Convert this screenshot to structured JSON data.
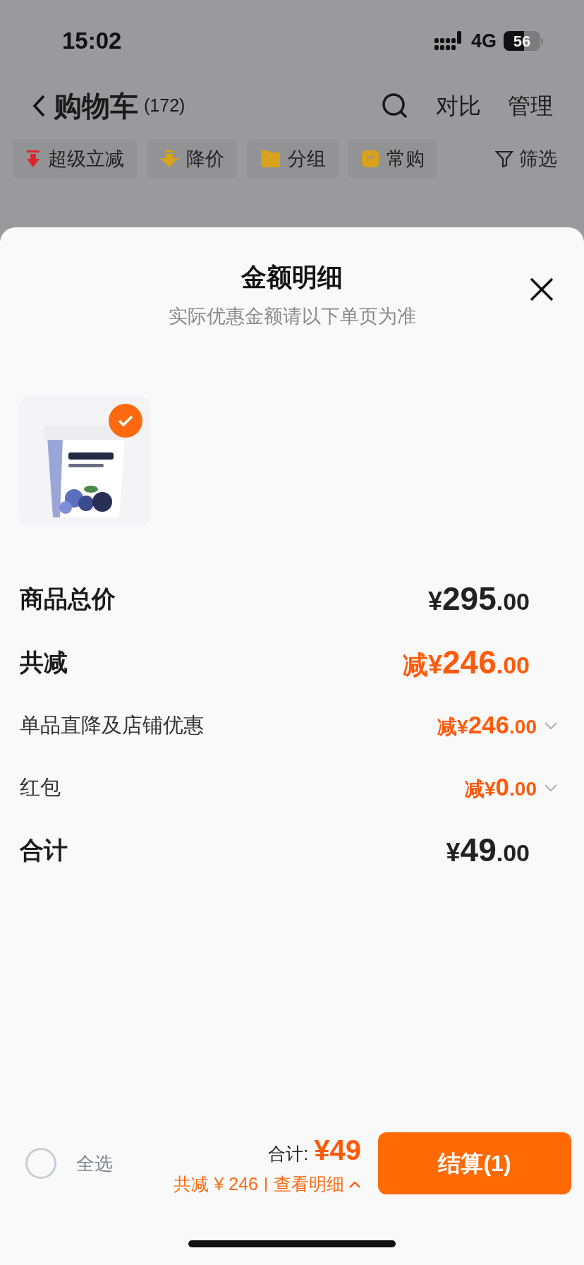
{
  "status_bar": {
    "time": "15:02",
    "network": "4G",
    "battery": "56"
  },
  "nav": {
    "title": "购物车",
    "count": "(172)",
    "actions": [
      "对比",
      "管理"
    ]
  },
  "chips": [
    {
      "label": "超级立减",
      "kind": "bolt"
    },
    {
      "label": "降价",
      "kind": "drop"
    },
    {
      "label": "分组",
      "kind": "folder"
    },
    {
      "label": "常购",
      "kind": "bag"
    }
  ],
  "filter": {
    "label": "筛选"
  },
  "sheet": {
    "title": "金额明细",
    "subtitle": "实际优惠金额请以下单页为准",
    "products": [
      {
        "kind": "picture",
        "selected": true
      }
    ],
    "rows": [
      {
        "label": "商品总价",
        "kind": "main",
        "highlight": false,
        "prefix": "",
        "currency": "¥",
        "whole": "295",
        "fraction": ".00"
      },
      {
        "label": "共减",
        "kind": "main",
        "highlight": true,
        "prefix": "减",
        "currency": "¥",
        "whole": "246",
        "fraction": ".00"
      },
      {
        "label": "单品直降及店铺优惠",
        "kind": "sub",
        "highlight": true,
        "prefix": "减",
        "currency": "¥",
        "whole": "246",
        "fraction": ".00"
      },
      {
        "label": "红包",
        "kind": "sub",
        "highlight": true,
        "prefix": "减",
        "currency": "¥",
        "whole": "0",
        "fraction": ".00"
      },
      {
        "label": "合计",
        "kind": "main",
        "highlight": false,
        "prefix": "",
        "currency": "¥",
        "whole": "49",
        "fraction": ".00"
      }
    ]
  },
  "bottom_bar": {
    "select_all": {
      "label": "全选",
      "checked": false
    },
    "total_label": "合计:",
    "total": "¥49",
    "saved": "共减 ¥ 246",
    "details_link": "查看明细",
    "checkout": "结算(1)"
  }
}
